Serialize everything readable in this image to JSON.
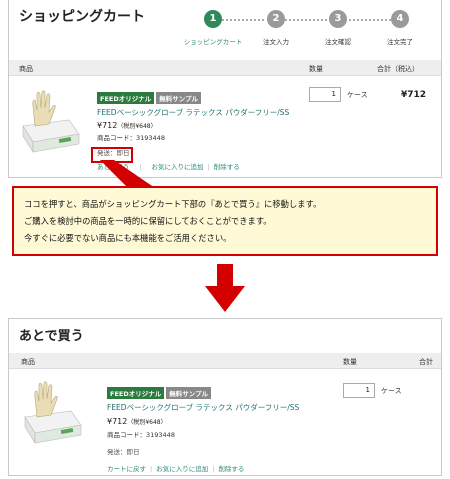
{
  "cart": {
    "title": "ショッピングカート",
    "steps": [
      {
        "num": "1",
        "label": "ショッピングカート",
        "active": true
      },
      {
        "num": "2",
        "label": "注文入力",
        "active": false
      },
      {
        "num": "3",
        "label": "注文確認",
        "active": false
      },
      {
        "num": "4",
        "label": "注文完了",
        "active": false
      }
    ],
    "headers": {
      "product": "商品",
      "qty": "数量",
      "total": "合計（税込）"
    },
    "item": {
      "tag_original": "FEEDオリジナル",
      "tag_sample": "無料サンプル",
      "name": "FEEDベーシックグローブ ラテックス パウダーフリー/SS",
      "price": "¥712",
      "price_tax": "（税別¥648）",
      "code": "商品コード：3193448",
      "shipping": "発送：即日",
      "qty": "1",
      "unit": "ケース",
      "total": "¥712",
      "links": {
        "later": "あとで買う",
        "favorite": "お気に入りに追加",
        "delete": "削除する"
      }
    }
  },
  "callout": {
    "line1": "ココを押すと、商品がショッピングカート下部の『あとで買う』に移動します。",
    "line2": "ご購入を検討中の商品を一時的に保留にしておくことができます。",
    "line3": "今すぐに必要でない商品にも本機能をご活用ください。"
  },
  "later": {
    "title": "あとで買う",
    "headers": {
      "product": "商品",
      "qty": "数量",
      "total": "合計"
    },
    "item": {
      "tag_original": "FEEDオリジナル",
      "tag_sample": "無料サンプル",
      "name": "FEEDベーシックグローブ ラテックス パウダーフリー/SS",
      "price": "¥712",
      "price_tax": "（税別¥648）",
      "code": "商品コード：3193448",
      "shipping": "発送：即日",
      "qty": "1",
      "unit": "ケース",
      "links": {
        "back": "カートに戻す",
        "favorite": "お気に入りに追加",
        "delete": "削除する"
      }
    }
  },
  "colors": {
    "accent": "#2f8a5b",
    "highlight": "#d20000",
    "callout_bg": "#fff9d6"
  }
}
